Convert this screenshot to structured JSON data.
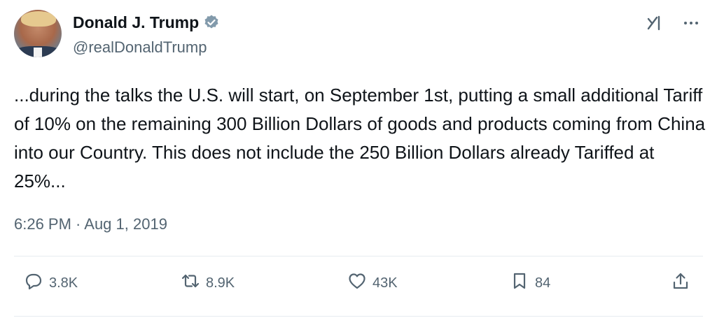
{
  "author": {
    "name": "Donald J. Trump",
    "handle": "@realDonaldTrump",
    "verified": true,
    "verified_color": "#829aab"
  },
  "top_icons": [
    "grok-icon",
    "more-icon"
  ],
  "tweet": {
    "text": "...during the talks the U.S. will start, on September 1st, putting a small additional Tariff of 10% on the remaining 300 Billion Dollars of goods and products coming from China into our Country. This does not include the 250 Billion Dollars already Tariffed at 25%...",
    "timestamp": "6:26 PM · Aug 1, 2019"
  },
  "stats": {
    "replies": "3.8K",
    "reposts": "8.9K",
    "likes": "43K",
    "bookmarks": "84"
  },
  "colors": {
    "text": "#0f1419",
    "secondary": "#536471",
    "divider": "#e6ecf0"
  }
}
